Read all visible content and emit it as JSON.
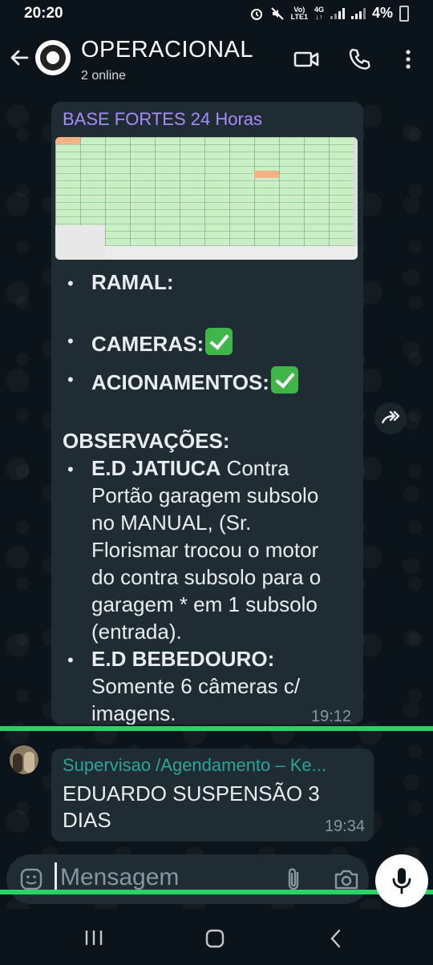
{
  "status_bar": {
    "time": "20:20",
    "network_top": "Vo)",
    "network_bottom": "LTE1",
    "network_type_top": "4G",
    "battery": "4%"
  },
  "header": {
    "title": "OPERACIONAL",
    "subtitle": "2 online",
    "avatar_text": "OPERACIONAL"
  },
  "messages": [
    {
      "sender": "BASE FORTES 24 Horas",
      "sender_color": "#a78bfa",
      "bullets_top": [
        "RAMAL:",
        "CAMERAS:",
        "ACIONAMENTOS:"
      ],
      "observacoes_title": "OBSERVAÇÕES:",
      "obs1_bold": "E.D JATIUCA",
      "obs1_lines": [
        "Contra",
        "Portão garagem subsolo",
        "no MANUAL, (Sr.",
        "Florismar trocou o motor",
        "do contra subsolo para o",
        "garagem * em 1 subsolo",
        "(entrada)."
      ],
      "obs2_bold": "E.D BEBEDOURO:",
      "obs2_lines": [
        "Somente 6 câmeras c/",
        "imagens."
      ],
      "time": "19:12"
    },
    {
      "sender": "Supervisao /Agendamento – Ke...",
      "sender_color": "#2ba59a",
      "text": "EDUARDO SUSPENSÃO 3 DIAS",
      "time": "19:34"
    }
  ],
  "composer": {
    "placeholder": "Mensagem"
  },
  "colors": {
    "background": "#0b141a",
    "bubble": "#1f2c34",
    "accent_green": "#25d366",
    "check_green": "#3fb54a"
  },
  "icons": [
    "back-arrow-icon",
    "video-call-icon",
    "phone-call-icon",
    "more-options-icon",
    "forward-icon",
    "emoji-icon",
    "attach-icon",
    "camera-icon",
    "mic-icon",
    "recent-apps-icon",
    "home-icon",
    "back-nav-icon"
  ]
}
